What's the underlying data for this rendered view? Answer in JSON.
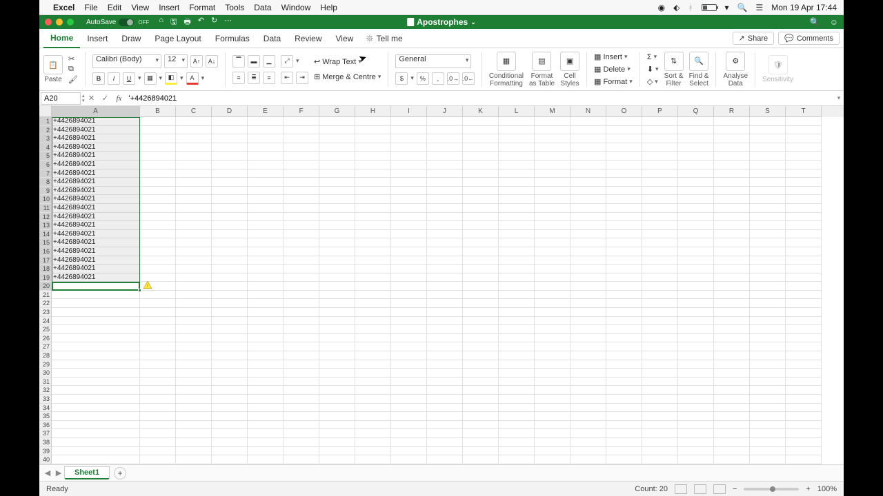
{
  "mac_menu": {
    "app": "Excel",
    "items": [
      "File",
      "Edit",
      "View",
      "Insert",
      "Format",
      "Tools",
      "Data",
      "Window",
      "Help"
    ],
    "clock": "Mon 19 Apr  17:44"
  },
  "titlebar": {
    "autosave_label": "AutoSave",
    "autosave_state": "OFF",
    "doc_name": "Apostrophes"
  },
  "ribbon_tabs": [
    "Home",
    "Insert",
    "Draw",
    "Page Layout",
    "Formulas",
    "Data",
    "Review",
    "View"
  ],
  "ribbon_tabs_active": "Home",
  "tellme": "Tell me",
  "share_label": "Share",
  "comments_label": "Comments",
  "ribbon": {
    "paste": "Paste",
    "font_name": "Calibri (Body)",
    "font_size": "12",
    "wrap_text": "Wrap Text",
    "merge": "Merge & Centre",
    "number_format": "General",
    "cond_fmt": "Conditional\nFormatting",
    "fmt_table": "Format\nas Table",
    "cell_styles": "Cell\nStyles",
    "insert": "Insert",
    "delete": "Delete",
    "format": "Format",
    "sort_filter": "Sort &\nFilter",
    "find_select": "Find &\nSelect",
    "analyse": "Analyse\nData",
    "sensitivity": "Sensitivity"
  },
  "formula_bar": {
    "name_box": "A20",
    "formula": "'+4426894021"
  },
  "columns": [
    "A",
    "B",
    "C",
    "D",
    "E",
    "F",
    "G",
    "H",
    "I",
    "J",
    "K",
    "L",
    "M",
    "N",
    "O",
    "P",
    "Q",
    "R",
    "S",
    "T"
  ],
  "cell_value": "+4426894021",
  "data_rows": 20,
  "total_rows": 40,
  "sheet_tab": "Sheet1",
  "status": {
    "ready": "Ready",
    "count": "Count: 20",
    "zoom": "100%"
  }
}
